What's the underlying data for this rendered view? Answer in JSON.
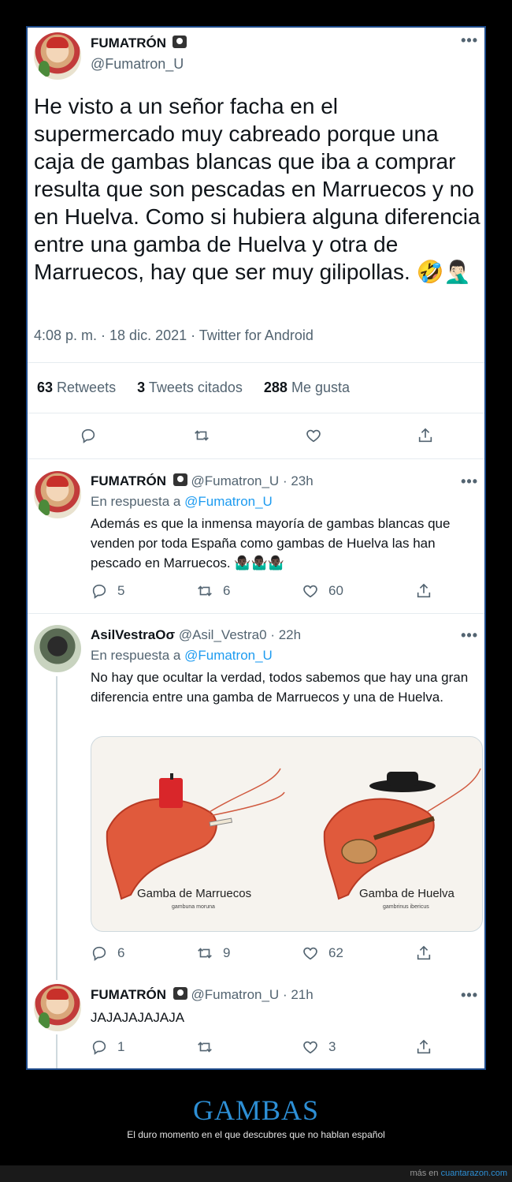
{
  "main_tweet": {
    "name": "FUMATRÓN",
    "handle": "@Fumatron_U",
    "text": "He visto a un señor facha en el supermercado muy cabreado porque una caja de gambas blancas que iba a comprar resulta que son pescadas en Marruecos y no en Huelva. Como si hubiera alguna diferencia entre una gamba de Huelva y otra de Marruecos, hay que ser muy gilipollas. 🤣🤦🏻‍♂️",
    "meta": "4:08 p. m. · 18 dic. 2021 · Twitter for Android",
    "retweets_count": "63",
    "retweets_label": "Retweets",
    "quotes_count": "3",
    "quotes_label": "Tweets citados",
    "likes_count": "288",
    "likes_label": "Me gusta"
  },
  "replies": [
    {
      "name": "FUMATRÓN",
      "handle": "@Fumatron_U",
      "time": "· 23h",
      "reply_to_label": "En respuesta a",
      "reply_to": "@Fumatron_U",
      "text": "Además es que la inmensa mayoría de gambas blancas que venden por toda España como gambas de Huelva las han pescado en Marruecos. 🤷🏿‍♂️🤷🏿‍♂️🤷🏿‍♂️",
      "replies": "5",
      "retweets": "6",
      "likes": "60"
    },
    {
      "name": "AsilVestraOσ",
      "handle": "@Asil_Vestra0",
      "time": "· 22h",
      "reply_to_label": "En respuesta a",
      "reply_to": "@Fumatron_U",
      "text": "No hay que ocultar la verdad, todos sabemos que hay una gran diferencia entre una gamba de Marruecos y una de Huelva.",
      "media": {
        "left_caption": "Gamba de Marruecos",
        "left_sub": "gambuna moruna",
        "right_caption": "Gamba de Huelva",
        "right_sub": "gambrinus ibericus"
      },
      "replies": "6",
      "retweets": "9",
      "likes": "62"
    },
    {
      "name": "FUMATRÓN",
      "handle": "@Fumatron_U",
      "time": "· 21h",
      "text": "JAJAJAJAJAJA",
      "replies": "1",
      "retweets": "",
      "likes": "3"
    }
  ],
  "footer": {
    "title": "GAMBAS",
    "subtitle": "El duro momento en el que descubres que no hablan español",
    "more_prefix": "más en",
    "more_link": "cuantarazon.com"
  },
  "icons": {
    "reply": "reply-icon",
    "retweet": "retweet-icon",
    "like": "heart-icon",
    "share": "share-icon",
    "more": "more-icon"
  },
  "colors": {
    "accent": "#1d9bf0",
    "muted": "#536471",
    "footer_title": "#2d8fd5"
  }
}
